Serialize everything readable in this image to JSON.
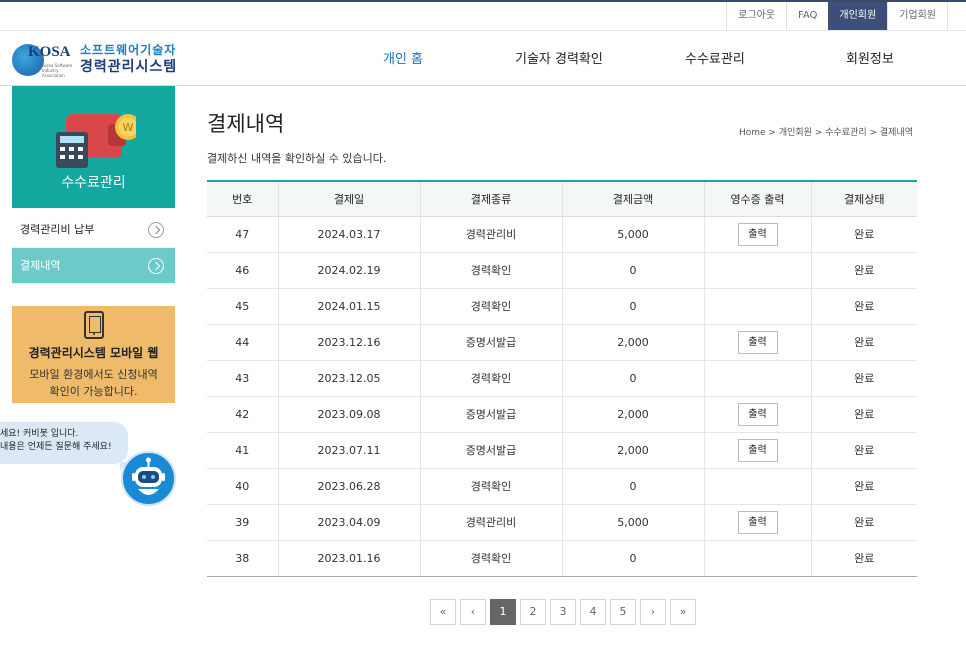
{
  "util_links": [
    "로그아웃",
    "FAQ",
    "개인회원",
    "기업회원"
  ],
  "logo": {
    "brand": "KOSA",
    "brand_sub_1": "Korea Software",
    "brand_sub_2": "Industry Association",
    "line1": "소프트웨어기술자",
    "line2": "경력관리시스템"
  },
  "gnb": [
    "개인 홈",
    "기술자 경력확인",
    "수수료관리",
    "회원정보"
  ],
  "sidebar": {
    "title": "수수료관리",
    "wallet_coin": "W",
    "items": [
      "경력관리비 납부",
      "결제내역"
    ]
  },
  "mobile_box": {
    "title": "경력관리시스템 모바일 웹",
    "desc1": "모바일 환경에서도 신청내역",
    "desc2": "확인이 가능합니다."
  },
  "chatbot": {
    "line1": "세요! 커비봇 입니다.",
    "line2": "내용은 언제든 질문해 주세요!"
  },
  "page": {
    "title": "결제내역",
    "breadcrumb": "Home > 개인회원 > 수수료관리 > 결제내역",
    "desc": "결제하신 내역을 확인하실 수 있습니다."
  },
  "table": {
    "headers": [
      "번호",
      "결제일",
      "결제종류",
      "결제금액",
      "영수증 출력",
      "결제상태"
    ],
    "receipt_label": "출력",
    "rows": [
      [
        "47",
        "2024.03.17",
        "경력관리비",
        "5,000",
        "출력",
        "완료"
      ],
      [
        "46",
        "2024.02.19",
        "경력확인",
        "0",
        "",
        "완료"
      ],
      [
        "45",
        "2024.01.15",
        "경력확인",
        "0",
        "",
        "완료"
      ],
      [
        "44",
        "2023.12.16",
        "증명서발급",
        "2,000",
        "출력",
        "완료"
      ],
      [
        "43",
        "2023.12.05",
        "경력확인",
        "0",
        "",
        "완료"
      ],
      [
        "42",
        "2023.09.08",
        "증명서발급",
        "2,000",
        "출력",
        "완료"
      ],
      [
        "41",
        "2023.07.11",
        "증명서발급",
        "2,000",
        "출력",
        "완료"
      ],
      [
        "40",
        "2023.06.28",
        "경력확인",
        "0",
        "",
        "완료"
      ],
      [
        "39",
        "2023.04.09",
        "경력관리비",
        "5,000",
        "출력",
        "완료"
      ],
      [
        "38",
        "2023.01.16",
        "경력확인",
        "0",
        "",
        "완료"
      ]
    ]
  },
  "pager": [
    "«",
    "‹",
    "1",
    "2",
    "3",
    "4",
    "5",
    "›",
    "»"
  ],
  "pager_active": "1",
  "colors": {
    "teal": "#14a7a0",
    "teal_light": "#6ccbc8",
    "navy": "#3d4f79",
    "orange": "#efbb6b",
    "link_blue": "#1b74c0"
  }
}
